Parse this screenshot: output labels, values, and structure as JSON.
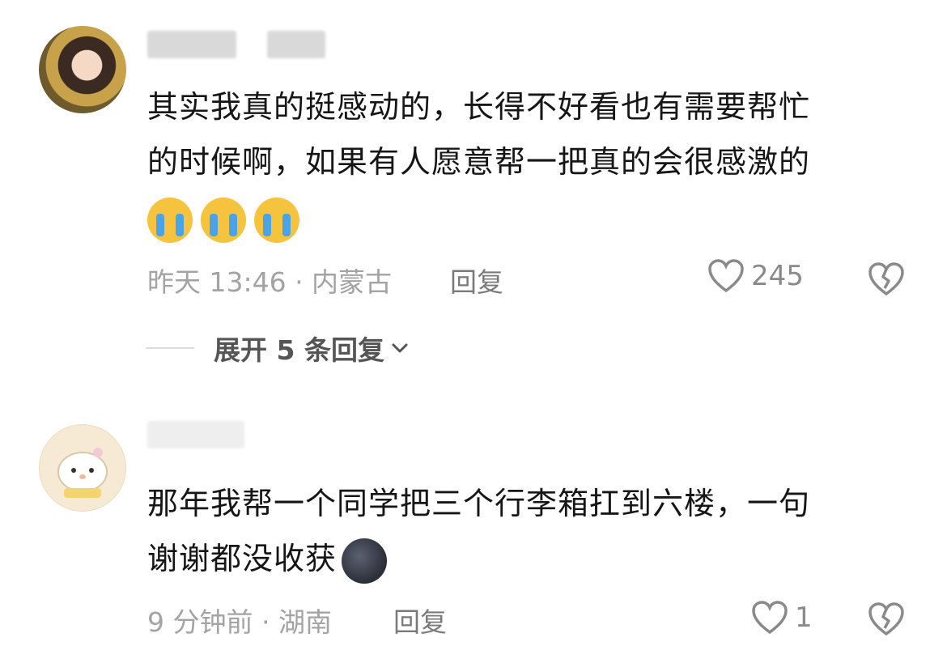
{
  "comments": [
    {
      "text_line1": "其实我真的挺感动的，长得不好看也有需要帮忙",
      "text_line2": "的时候啊，如果有人愿意帮一把真的会很感激的",
      "emojis": [
        "loudly-crying-face",
        "loudly-crying-face",
        "loudly-crying-face"
      ],
      "meta": "昨天 13:46 · 内蒙古",
      "reply_label": "回复",
      "likes": "245",
      "expand_label": "展开 5 条回复"
    },
    {
      "text_line1": "那年我帮一个同学把三个行李箱扛到六楼，一句",
      "text_line2": "谢谢都没收获",
      "emojis": [
        "new-moon-face"
      ],
      "meta": "9 分钟前 · 湖南",
      "reply_label": "回复",
      "likes": "1"
    }
  ],
  "colors": {
    "text": "#161616",
    "meta": "#a3a3a3",
    "accent_gray": "#7a7a7a"
  }
}
